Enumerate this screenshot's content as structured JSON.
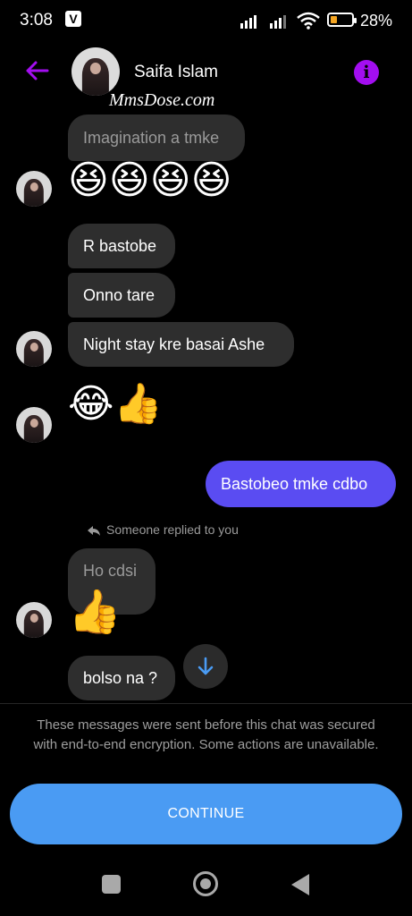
{
  "status_bar": {
    "time": "3:08",
    "app_badge": "V",
    "battery_pct": "28%"
  },
  "header": {
    "contact_name": "Saifa Islam",
    "watermark": "MmsDose.com",
    "info_glyph": "i"
  },
  "messages": {
    "m1": "Imagination a tmke",
    "m1_emoji": "😆😆😆😆",
    "m2": "R bastobe",
    "m3": "Onno tare",
    "m4": "Night stay kre basai Ashe",
    "m5_emoji": "😂👍",
    "m6_out": "Bastobeo tmke cdbo",
    "replied_note": "Someone replied to you",
    "m7": "Ho cdsi",
    "m7_reaction": "👍",
    "m8": "bolso na ?"
  },
  "notice": "These messages were sent before this chat was secured with end-to-end encryption. Some actions are unavailable.",
  "continue_button": "CONTINUE",
  "colors": {
    "accent_purple": "#a30ef0",
    "outgoing_bubble": "#5a4cf2",
    "incoming_bubble": "#2e2e2e",
    "continue_blue": "#4a9bf3"
  },
  "icons": [
    "back-arrow-icon",
    "info-icon",
    "reply-arrow-icon",
    "scroll-down-icon",
    "home-icon",
    "recents-icon",
    "nav-back-icon",
    "wifi-icon",
    "signal-icon",
    "battery-icon"
  ]
}
